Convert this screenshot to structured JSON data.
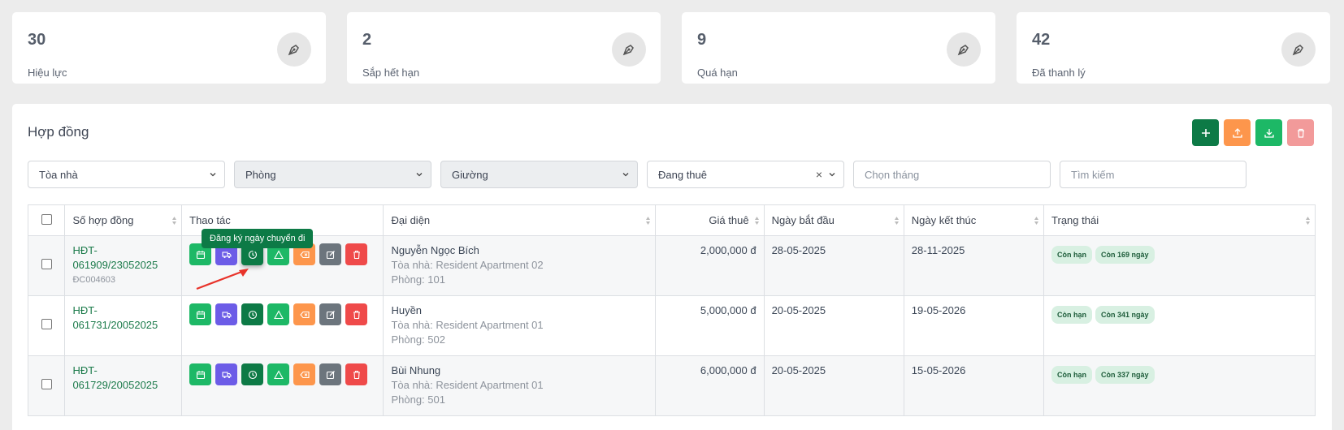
{
  "stats": [
    {
      "value": "30",
      "label": "Hiệu lực",
      "icon": "pen-nib-icon"
    },
    {
      "value": "2",
      "label": "Sắp hết hạn",
      "icon": "pen-nib-icon"
    },
    {
      "value": "9",
      "label": "Quá hạn",
      "icon": "pen-nib-icon"
    },
    {
      "value": "42",
      "label": "Đã thanh lý",
      "icon": "pen-nib-icon"
    }
  ],
  "panel": {
    "title": "Hợp đồng"
  },
  "toolbar": {
    "add": "plus-icon",
    "upload": "upload-icon",
    "download": "download-icon",
    "delete": "trash-icon"
  },
  "filters": {
    "building": "Tòa nhà",
    "room": "Phòng",
    "bed": "Giường",
    "status": "Đang thuê",
    "month_placeholder": "Chọn tháng",
    "search_placeholder": "Tìm kiếm"
  },
  "table": {
    "headers": {
      "code": "Số hợp đồng",
      "actions": "Thao tác",
      "rep": "Đại diện",
      "price": "Giá thuê",
      "start": "Ngày bắt đầu",
      "end": "Ngày kết thúc",
      "status": "Trạng thái"
    },
    "rows": [
      {
        "code1": "HĐT-",
        "code2": "061909/23052025",
        "subcode": "ĐC004603",
        "name": "Nguyễn Ngọc Bích",
        "building": "Tòa nhà: Resident Apartment 02",
        "room": "Phòng: 101",
        "price": "2,000,000 đ",
        "start": "28-05-2025",
        "end": "28-11-2025",
        "badge1": "Còn hạn",
        "badge2": "Còn 169 ngày"
      },
      {
        "code1": "HĐT-",
        "code2": "061731/20052025",
        "subcode": "",
        "name": "Huyền",
        "building": "Tòa nhà: Resident Apartment 01",
        "room": "Phòng: 502",
        "price": "5,000,000 đ",
        "start": "20-05-2025",
        "end": "19-05-2026",
        "badge1": "Còn hạn",
        "badge2": "Còn 341 ngày"
      },
      {
        "code1": "HĐT-",
        "code2": "061729/20052025",
        "subcode": "",
        "name": "Bùi Nhung",
        "building": "Tòa nhà: Resident Apartment 01",
        "room": "Phòng: 501",
        "price": "6,000,000 đ",
        "start": "20-05-2025",
        "end": "15-05-2026",
        "badge1": "Còn hạn",
        "badge2": "Còn 337 ngày"
      }
    ]
  },
  "tooltip": "Đăng ký ngày chuyển đi",
  "colors": {
    "green": "#1db866",
    "darkgreen": "#0d7a46",
    "purple": "#6c5ce7",
    "orange": "#fd964c",
    "gray": "#6c757d",
    "red": "#ef4a4a"
  }
}
